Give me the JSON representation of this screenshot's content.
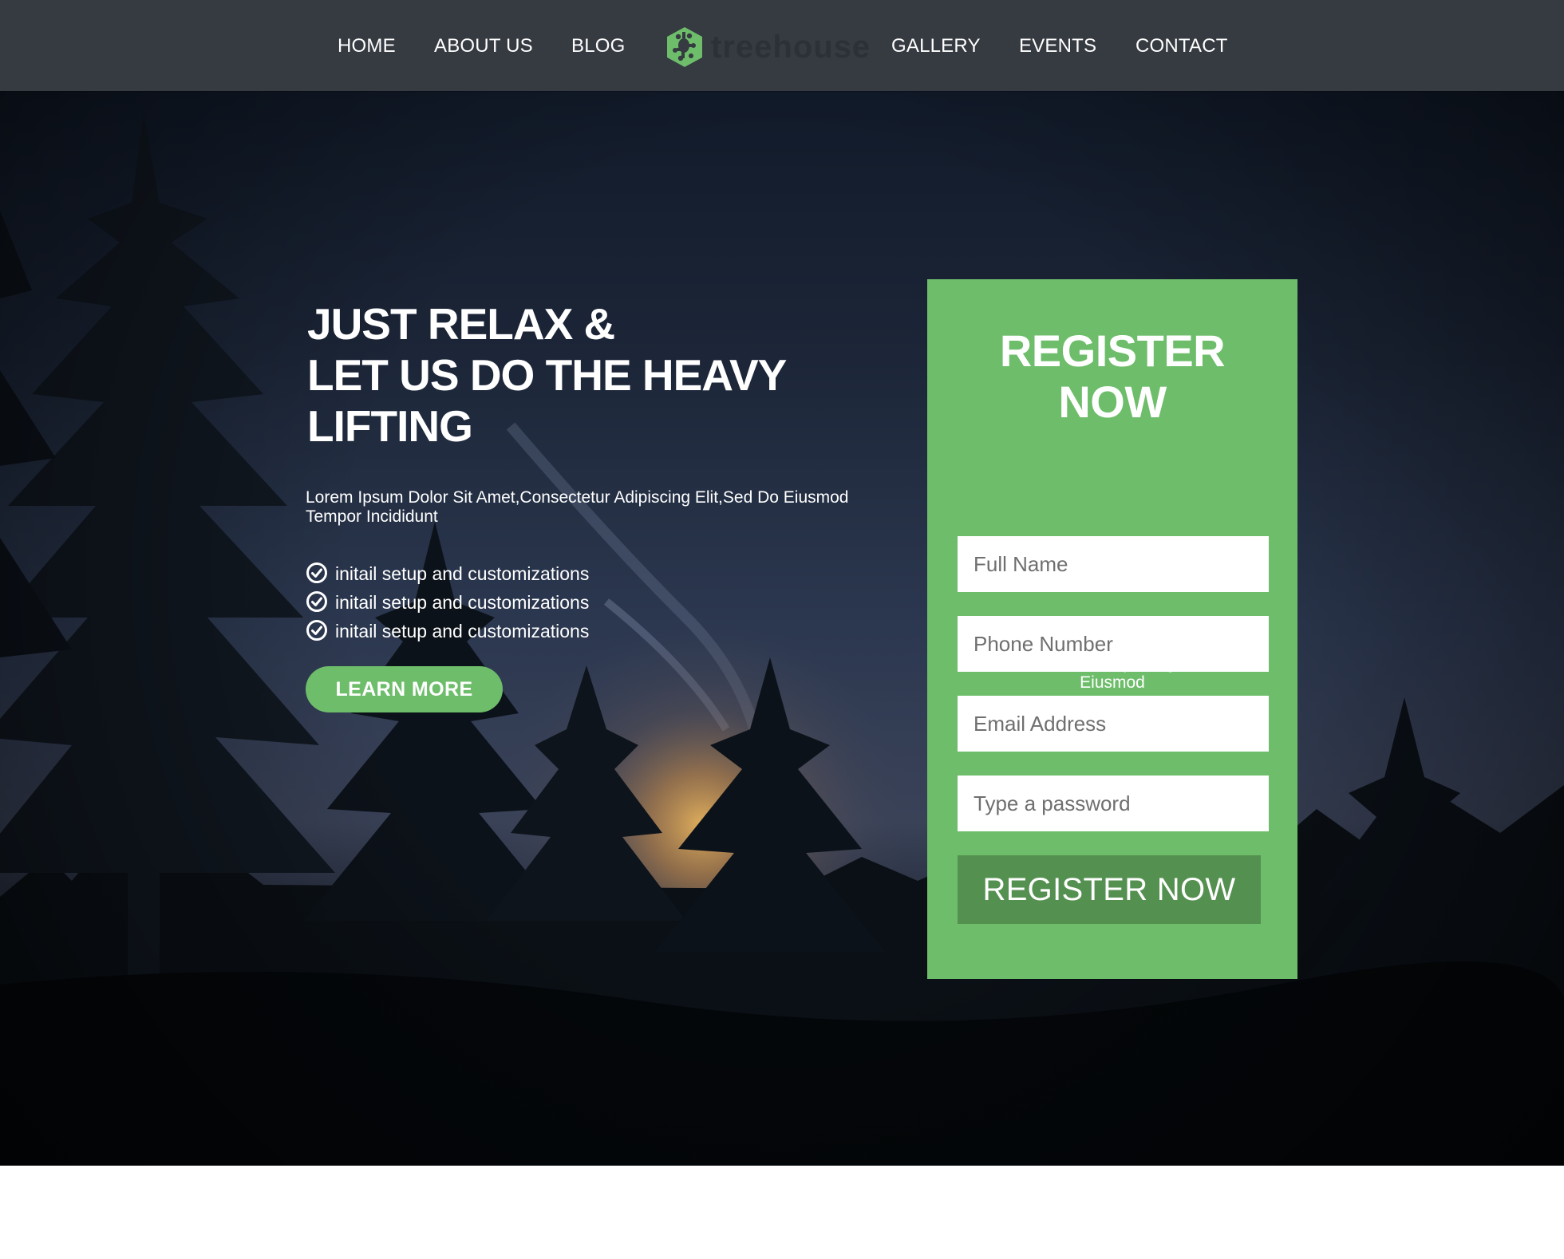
{
  "nav": {
    "items": [
      {
        "label": "HOME"
      },
      {
        "label": "ABOUT US"
      },
      {
        "label": "BLOG"
      },
      {
        "label": "GALLERY"
      },
      {
        "label": "EVENTS"
      },
      {
        "label": "CONTACT"
      }
    ],
    "logo": {
      "text": "treehouse",
      "icon": "treehouse-frog-hexagon-icon",
      "mark_color": "#6dbd6a"
    }
  },
  "hero": {
    "title_lines": [
      "JUST RELAX &",
      "LET US DO THE HEAVY",
      "LIFTING"
    ],
    "description": "Lorem Ipsum Dolor Sit Amet,Consectetur Adipiscing Elit,Sed Do Eiusmod Tempor Incididunt",
    "features": [
      {
        "text": "initail setup and customizations",
        "icon": "check-circle-icon"
      },
      {
        "text": "initail setup and customizations",
        "icon": "check-circle-icon"
      },
      {
        "text": "initail setup and customizations",
        "icon": "check-circle-icon"
      }
    ],
    "cta_label": "LEARN MORE",
    "background": "night-forest-sunset-photo"
  },
  "register": {
    "title_lines": [
      "REGISTER",
      "NOW"
    ],
    "description": "Lorem Lpsum Dolor Sit Amet,Consectetur Adipiscing Elit,Sed Do Eiusmod",
    "fields": [
      {
        "placeholder": "Full Name",
        "value": ""
      },
      {
        "placeholder": "Phone Number",
        "value": ""
      },
      {
        "placeholder": "Email Address",
        "value": ""
      },
      {
        "placeholder": "Type a password",
        "value": ""
      }
    ],
    "submit_label": "REGISTER NOW"
  },
  "colors": {
    "accent": "#6dbd6a",
    "accent_dark": "#549050",
    "navbar": "#363a41",
    "text_light": "#ffffff"
  }
}
